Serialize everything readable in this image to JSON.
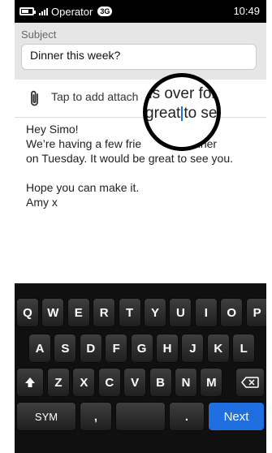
{
  "status_bar": {
    "operator": "Operator",
    "network_badge": "3G",
    "time": "10:49",
    "battery_level": 0.7,
    "signal_bars": 4
  },
  "compose": {
    "subject_label": "Subject",
    "subject_value": "Dinner this week?",
    "attach_label": "Tap to add attach",
    "body_lines": [
      "Hey Simo!",
      "We’re having a few frie",
      "dinner",
      "on Tuesday. It would be great to see you.",
      "Hope you can make it.",
      "Amy x"
    ]
  },
  "magnifier": {
    "line1": "ds over for",
    "line2_before": "great",
    "line2_after": "to se"
  },
  "keyboard": {
    "row1": [
      "Q",
      "W",
      "E",
      "R",
      "T",
      "Y",
      "U",
      "I",
      "O",
      "P"
    ],
    "row2": [
      "A",
      "S",
      "D",
      "F",
      "G",
      "H",
      "J",
      "K",
      "L"
    ],
    "row3": [
      "Z",
      "X",
      "C",
      "V",
      "B",
      "N",
      "M"
    ],
    "shift_icon": "shift-icon",
    "backspace_icon": "backspace-icon",
    "sym_label": "SYM",
    "comma_label": ",",
    "period_label": ".",
    "next_label": "Next"
  },
  "colors": {
    "accent": "#1f6fe0",
    "keyboard_bg": "#101010",
    "subject_bg": "#e6e6e6"
  }
}
